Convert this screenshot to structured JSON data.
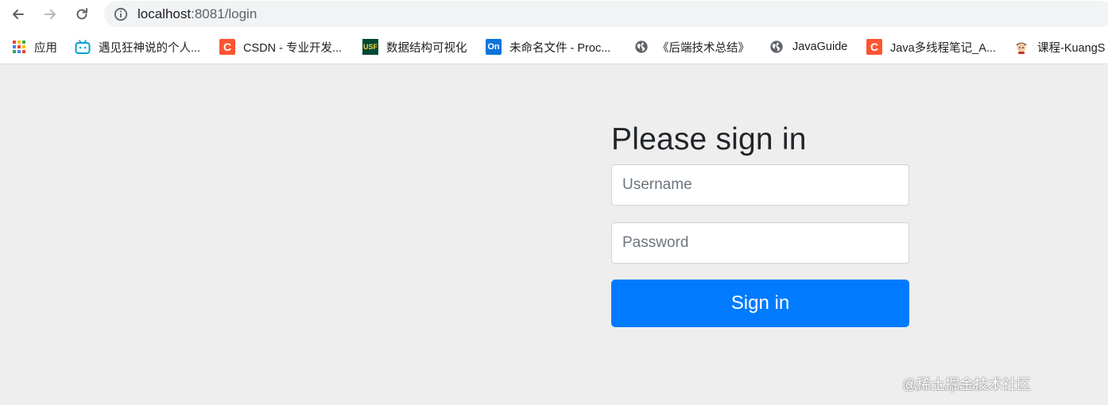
{
  "browser": {
    "url_host": "localhost",
    "url_rest": ":8081/login"
  },
  "bookmarks": [
    {
      "label": "应用",
      "icon": "apps-grid-icon"
    },
    {
      "label": "遇见狂神说的个人...",
      "icon": "bilibili-icon"
    },
    {
      "label": "CSDN - 专业开发...",
      "icon": "csdn-icon",
      "icon_text": "C"
    },
    {
      "label": "数据结构可视化",
      "icon": "usf-icon",
      "icon_text": "USF"
    },
    {
      "label": "未命名文件 - Proc...",
      "icon": "processon-icon",
      "icon_text": "On"
    },
    {
      "label": "《后端技术总结》",
      "icon": "globe-icon"
    },
    {
      "label": "JavaGuide",
      "icon": "globe-icon"
    },
    {
      "label": "Java多线程笔记_A...",
      "icon": "csdn-icon",
      "icon_text": "C"
    },
    {
      "label": "课程-KuangS",
      "icon": "avatar-icon"
    }
  ],
  "login": {
    "heading": "Please sign in",
    "username_placeholder": "Username",
    "password_placeholder": "Password",
    "button_label": "Sign in"
  },
  "watermark": {
    "text": "@稀土掘金技术社区",
    "url": "https://blog.csdn.net/..."
  },
  "colors": {
    "primary": "#007bff",
    "page_bg": "#eeeeee",
    "csdn": "#fc5531",
    "bilibili": "#00a1d6",
    "processon": "#0a74da"
  }
}
